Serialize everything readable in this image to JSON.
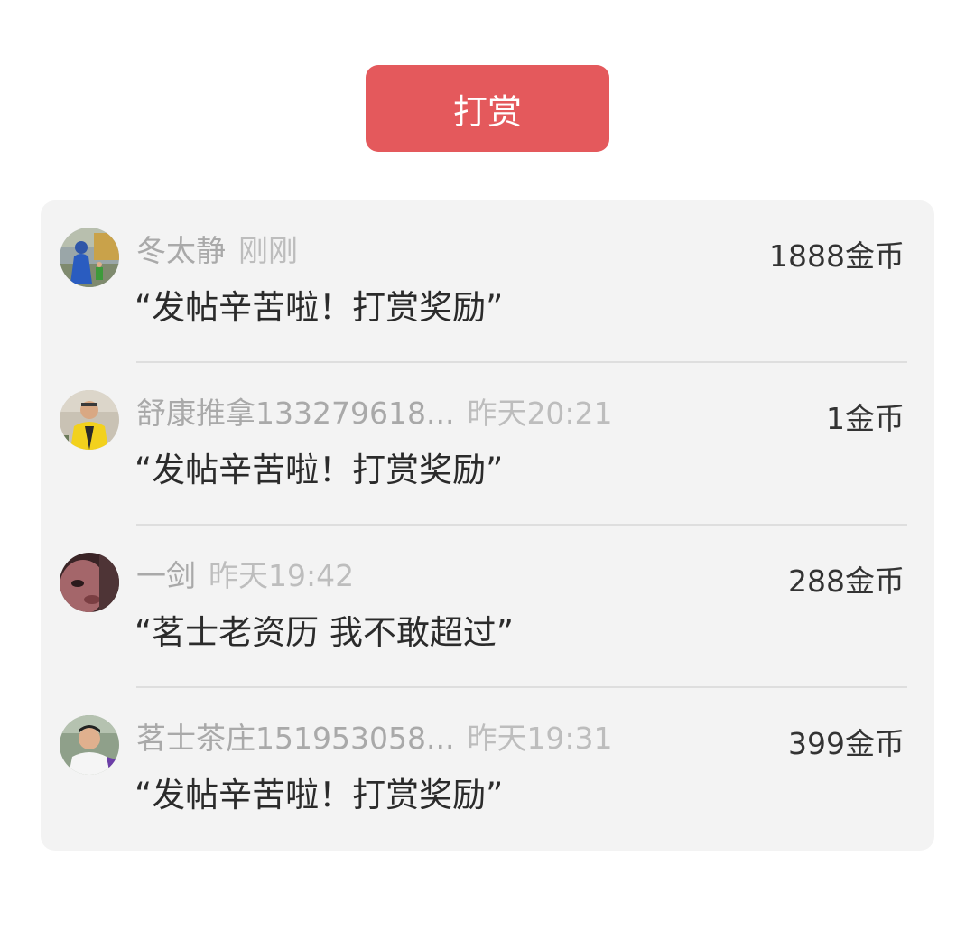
{
  "reward_button": {
    "label": "打赏"
  },
  "colors": {
    "accent": "#e4595c",
    "list_background": "#f3f3f3",
    "meta_text": "#a9a9a9",
    "message_text": "#2b2b2b",
    "footer_text": "#e26c3c"
  },
  "rewards": [
    {
      "name": "冬太静",
      "time": "刚刚",
      "amount": "1888金币",
      "message": "“发帖辛苦啦！打赏奖励”",
      "avatar_icon": "avatar-outdoor-photo-icon"
    },
    {
      "name": "舒康推拿133279618...",
      "time": "昨天20:21",
      "amount": "1金币",
      "message": "“发帖辛苦啦！打赏奖励”",
      "avatar_icon": "avatar-yellow-jacket-icon"
    },
    {
      "name": "一剑",
      "time": "昨天19:42",
      "amount": "288金币",
      "message": "“茗士老资历 我不敢超过”",
      "avatar_icon": "avatar-face-closeup-icon"
    },
    {
      "name": "茗士茶庄151953058...",
      "time": "昨天19:31",
      "amount": "399金币",
      "message": "“发帖辛苦啦！打赏奖励”",
      "avatar_icon": "avatar-man-portrait-icon"
    }
  ]
}
